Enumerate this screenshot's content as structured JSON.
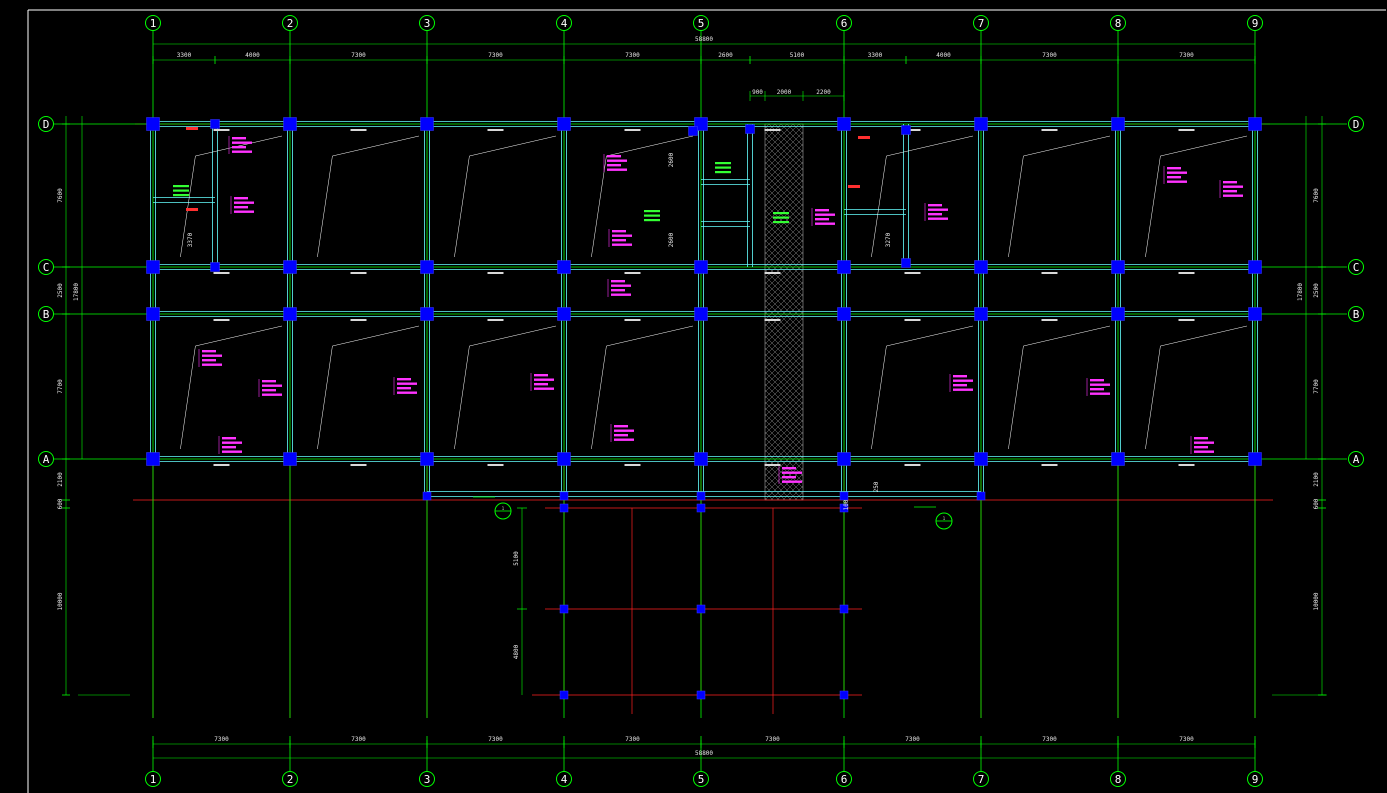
{
  "drawing": {
    "axes_x": [
      "1",
      "2",
      "3",
      "4",
      "5",
      "6",
      "7",
      "8",
      "9"
    ],
    "axes_y": [
      "D",
      "C",
      "B",
      "A"
    ],
    "top_spans": [
      "3300",
      "4000",
      "7300",
      "7300",
      "7300",
      "2600",
      "5100",
      "3300",
      "4000",
      "7300",
      "7300"
    ],
    "top_total": "58800",
    "stair_dims": [
      "900",
      "2000",
      "2200"
    ],
    "bottom_spans": [
      "7300",
      "7300",
      "7300",
      "7300",
      "7300",
      "7300",
      "7300",
      "7300"
    ],
    "bottom_total": "58800",
    "left_dims": [
      "7600",
      "2500",
      "7700",
      "2100",
      "600",
      "10000"
    ],
    "left_total": "17800",
    "right_dims": [
      "7600",
      "2500",
      "7700",
      "2100",
      "600",
      "10000"
    ],
    "right_total": "17800",
    "lower_dims": [
      "5100",
      "4800"
    ],
    "bay_dims": [
      "2600",
      "2600"
    ],
    "misc_dims": [
      "3370",
      "3270",
      "100",
      "250"
    ],
    "section_marks": [
      "1",
      "1"
    ],
    "colors": {
      "background": "#000000",
      "axis": "#00ff00",
      "beam": "#66ffff",
      "column": "#0000ff",
      "red_line": "#ff2020",
      "annotation": "#ff33ff",
      "note_green": "#33ff33",
      "hatch": "#a0a0a0",
      "text": "#ffffff"
    }
  }
}
